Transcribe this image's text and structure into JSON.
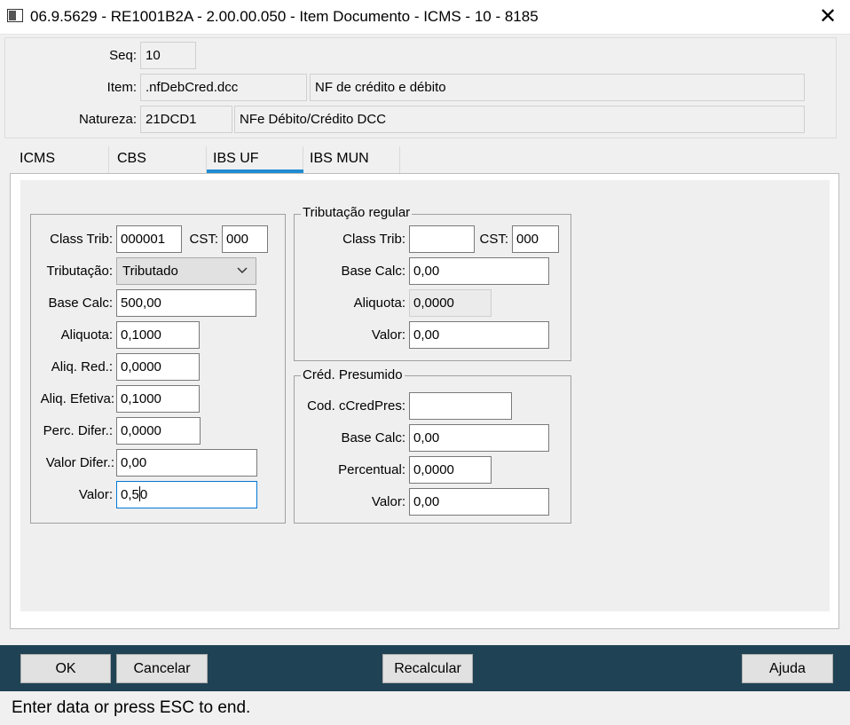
{
  "window": {
    "title": "06.9.5629 - RE1001B2A - 2.00.00.050 - Item Documento - ICMS - 10 - 8185",
    "close_glyph": "✕"
  },
  "header": {
    "seq_label": "Seq:",
    "seq_value": "10",
    "item_label": "Item:",
    "item_code": ".nfDebCred.dcc",
    "item_desc": "NF de crédito e débito",
    "natureza_label": "Natureza:",
    "natureza_code": "21DCD1",
    "natureza_desc": "NFe Débito/Crédito DCC"
  },
  "tabs": [
    {
      "label": "ICMS"
    },
    {
      "label": "CBS"
    },
    {
      "label": "IBS UF"
    },
    {
      "label": "IBS MUN"
    }
  ],
  "active_tab": "IBS UF",
  "left": {
    "class_trib_label": "Class Trib:",
    "class_trib_value": "000001",
    "cst_label": "CST:",
    "cst_value": "000",
    "tributacao_label": "Tributação:",
    "tributacao_value": "Tributado",
    "base_calc_label": "Base Calc:",
    "base_calc_value": "500,00",
    "aliquota_label": "Aliquota:",
    "aliquota_value": "0,1000",
    "aliq_red_label": "Aliq. Red.:",
    "aliq_red_value": "0,0000",
    "aliq_efetiva_label": "Aliq. Efetiva:",
    "aliq_efetiva_value": "0,1000",
    "perc_difer_label": "Perc. Difer.:",
    "perc_difer_value": "0,0000",
    "valor_difer_label": "Valor Difer.:",
    "valor_difer_value": "0,00",
    "valor_label": "Valor:",
    "valor_value_a": "0,5",
    "valor_value_b": "0"
  },
  "regular": {
    "title": "Tributação regular",
    "class_trib_label": "Class Trib:",
    "class_trib_value": "",
    "cst_label": "CST:",
    "cst_value": "000",
    "base_calc_label": "Base Calc:",
    "base_calc_value": "0,00",
    "aliquota_label": "Aliquota:",
    "aliquota_value": "0,0000",
    "valor_label": "Valor:",
    "valor_value": "0,00"
  },
  "presumido": {
    "title": "Créd. Presumido",
    "cod_label": "Cod. cCredPres:",
    "cod_value": "",
    "base_calc_label": "Base Calc:",
    "base_calc_value": "0,00",
    "percentual_label": "Percentual:",
    "percentual_value": "0,0000",
    "valor_label": "Valor:",
    "valor_value": "0,00"
  },
  "buttons": {
    "ok": "OK",
    "cancelar": "Cancelar",
    "recalcular": "Recalcular",
    "ajuda": "Ajuda"
  },
  "status": "Enter data or press ESC to end.",
  "colors": {
    "bottom_bar": "#1f4354",
    "active_tab_underline": "#1f8bd0"
  }
}
